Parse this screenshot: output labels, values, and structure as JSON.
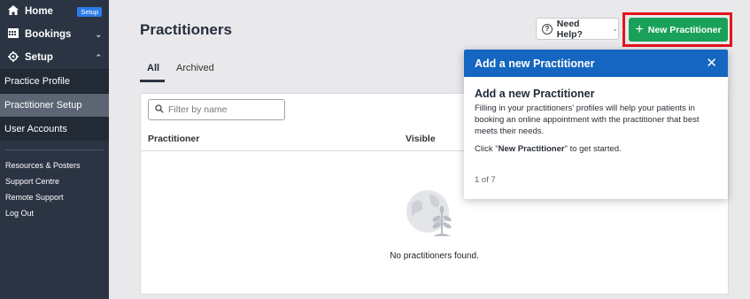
{
  "sidebar": {
    "home": {
      "label": "Home",
      "badge": "Setup"
    },
    "bookings": {
      "label": "Bookings"
    },
    "setup": {
      "label": "Setup",
      "items": [
        {
          "label": "Practice Profile"
        },
        {
          "label": "Practitioner Setup"
        },
        {
          "label": "User Accounts"
        }
      ]
    },
    "links": [
      {
        "label": "Resources & Posters"
      },
      {
        "label": "Support Centre"
      },
      {
        "label": "Remote Support"
      },
      {
        "label": "Log Out"
      }
    ]
  },
  "header": {
    "title": "Practitioners",
    "help_label": "Need Help?",
    "new_label": "New Practitioner"
  },
  "tabs": [
    {
      "label": "All"
    },
    {
      "label": "Archived"
    }
  ],
  "filter": {
    "placeholder": "Filter by name",
    "value": ""
  },
  "table": {
    "columns": [
      "Practitioner",
      "Visible"
    ],
    "empty_text": "No practitioners found."
  },
  "popover": {
    "header": "Add a new Practitioner",
    "title": "Add a new Practitioner",
    "body": "Filling in your practitioners' profiles will help your patients in booking an online appointment with the practitioner that best meets their needs.",
    "click_prefix": "Click \"",
    "click_strong": "New Practitioner",
    "click_suffix": "\" to get started.",
    "counter": "1 of 7"
  },
  "colors": {
    "sidebar_bg": "#2b3443",
    "active_item": "#5b6574",
    "primary_green": "#1aa159",
    "popover_blue": "#1566c0",
    "highlight_red": "#e3141c",
    "badge_blue": "#2b7de9"
  }
}
